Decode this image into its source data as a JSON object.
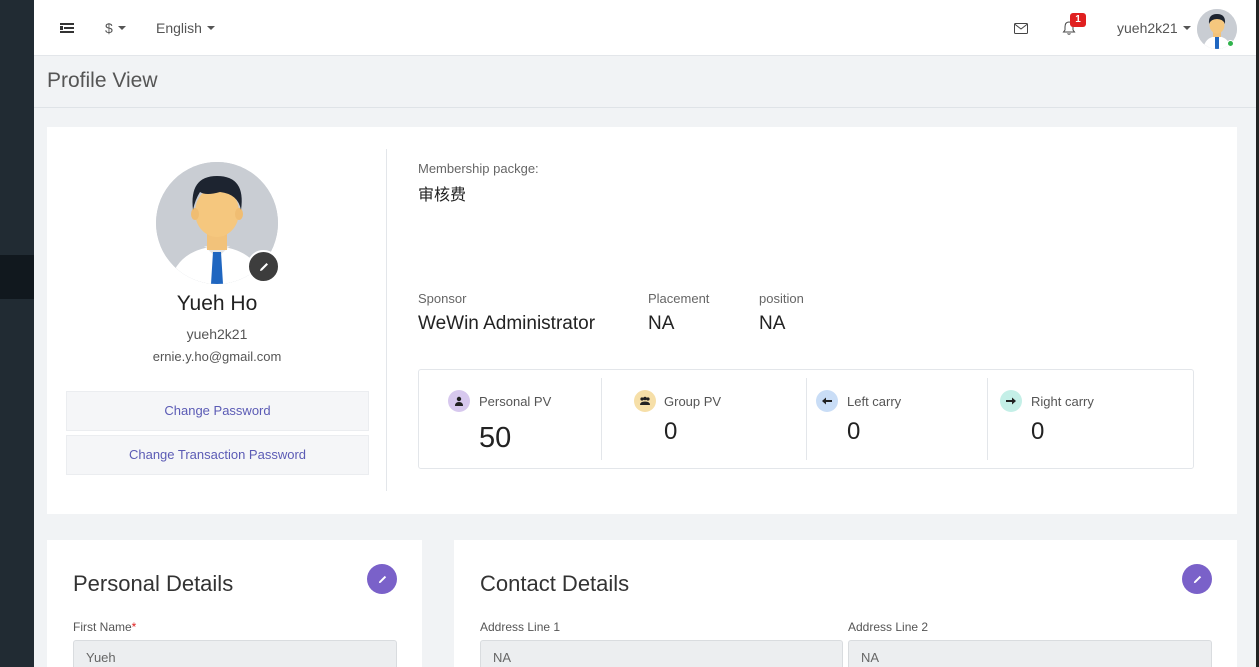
{
  "topbar": {
    "currency": "$",
    "language": "English",
    "notification_count": "1",
    "username": "yueh2k21"
  },
  "page": {
    "title": "Profile View"
  },
  "profile": {
    "name": "Yueh Ho",
    "username": "yueh2k21",
    "email": "ernie.y.ho@gmail.com",
    "change_password": "Change Password",
    "change_transaction_password": "Change Transaction Password"
  },
  "membership": {
    "label": "Membership packge:",
    "value": "审核费"
  },
  "sponsor": {
    "label": "Sponsor",
    "value": "WeWin Administrator"
  },
  "placement": {
    "label": "Placement",
    "value": "NA"
  },
  "position": {
    "label": "position",
    "value": "NA"
  },
  "stats": [
    {
      "label": "Personal PV",
      "value": "50",
      "icon": "user-icon",
      "color": "#d7c8ee"
    },
    {
      "label": "Group PV",
      "value": "0",
      "icon": "group-icon",
      "color": "#f6dfa8"
    },
    {
      "label": "Left carry",
      "value": "0",
      "icon": "arrow-left-icon",
      "color": "#c9ddf6"
    },
    {
      "label": "Right carry",
      "value": "0",
      "icon": "arrow-right-icon",
      "color": "#c4efe7"
    }
  ],
  "personal": {
    "title": "Personal Details",
    "first_name_label": "First Name",
    "first_name_value": "Yueh"
  },
  "contact": {
    "title": "Contact Details",
    "address1_label": "Address Line 1",
    "address1_value": "NA",
    "address2_label": "Address Line 2",
    "address2_value": "NA"
  },
  "colors": {
    "accent": "#7a61c9",
    "link": "#5b5bb5",
    "badge": "#e02020",
    "sidebar": "#212b33"
  }
}
